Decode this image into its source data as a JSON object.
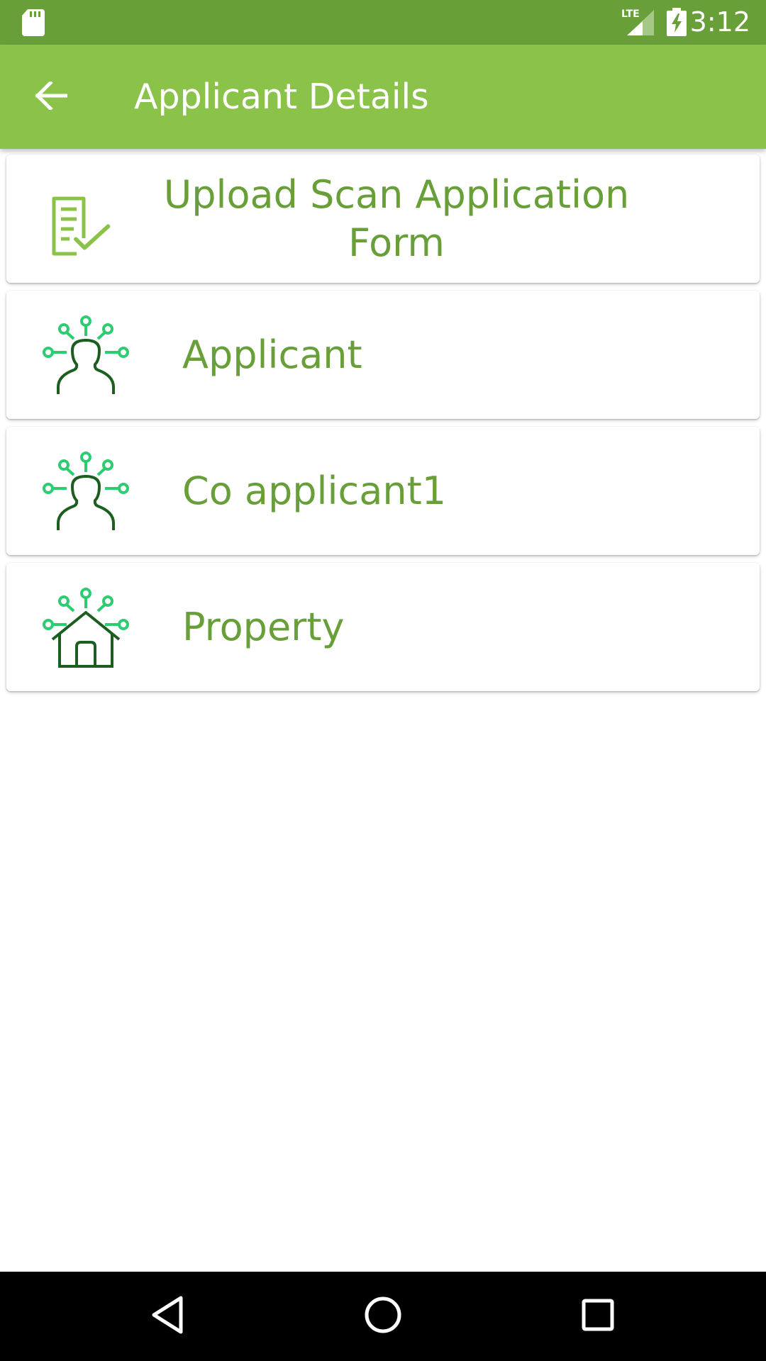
{
  "status_bar": {
    "time": "3:12",
    "network_label": "LTE",
    "icons": [
      "sd-card-icon",
      "signal-icon",
      "battery-charging-icon"
    ],
    "background_color": "#689f38"
  },
  "app_bar": {
    "title": "Applicant Details",
    "back_icon": "arrow-left-icon",
    "background_color": "#8bc34a"
  },
  "menu": {
    "label_color": "#689f38",
    "items": [
      {
        "label": "Upload Scan Application Form",
        "icon": "document-check-icon"
      },
      {
        "label": "Applicant",
        "icon": "person-network-icon"
      },
      {
        "label": "Co applicant1",
        "icon": "person-network-icon"
      },
      {
        "label": "Property",
        "icon": "house-network-icon"
      }
    ]
  },
  "nav_bar": {
    "buttons": [
      "back-triangle-icon",
      "home-circle-icon",
      "recents-square-icon"
    ]
  }
}
